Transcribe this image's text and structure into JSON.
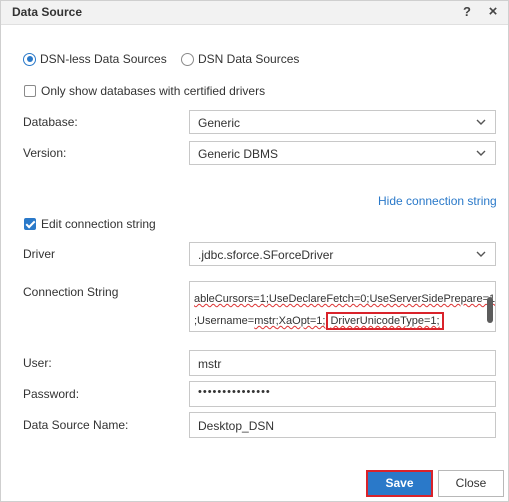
{
  "dialog": {
    "title": "Data Source",
    "help_label": "?",
    "close_label": "×"
  },
  "source_type": {
    "options": [
      {
        "label": "DSN-less Data Sources",
        "selected": true
      },
      {
        "label": "DSN Data Sources",
        "selected": false
      }
    ]
  },
  "certified_only": {
    "label": "Only show databases with certified drivers",
    "checked": false
  },
  "database": {
    "label": "Database:",
    "value": "Generic"
  },
  "version": {
    "label": "Version:",
    "value": "Generic DBMS"
  },
  "hide_conn_link": "Hide connection string",
  "edit_conn": {
    "label": "Edit connection string",
    "checked": true
  },
  "driver": {
    "label": "Driver",
    "value": ".jdbc.sforce.SForceDriver"
  },
  "connection_string": {
    "label": "Connection String",
    "line1": "ableCursors=1;UseDeclareFetch=0;UseServerSidePrepare=1",
    "line2_prefix": ";Username=",
    "line2_user": "mstr",
    "line2_mid": ";XaOpt=1;",
    "line2_highlight": "DriverUnicodeType=1;"
  },
  "user": {
    "label": "User:",
    "value": "mstr"
  },
  "password": {
    "label": "Password:",
    "value": "•••••••••••••••"
  },
  "dsn_name": {
    "label": "Data Source Name:",
    "value": "Desktop_DSN"
  },
  "buttons": {
    "save": "Save",
    "close": "Close"
  },
  "colors": {
    "accent": "#2a79c9",
    "highlight_border": "#d9232b"
  }
}
